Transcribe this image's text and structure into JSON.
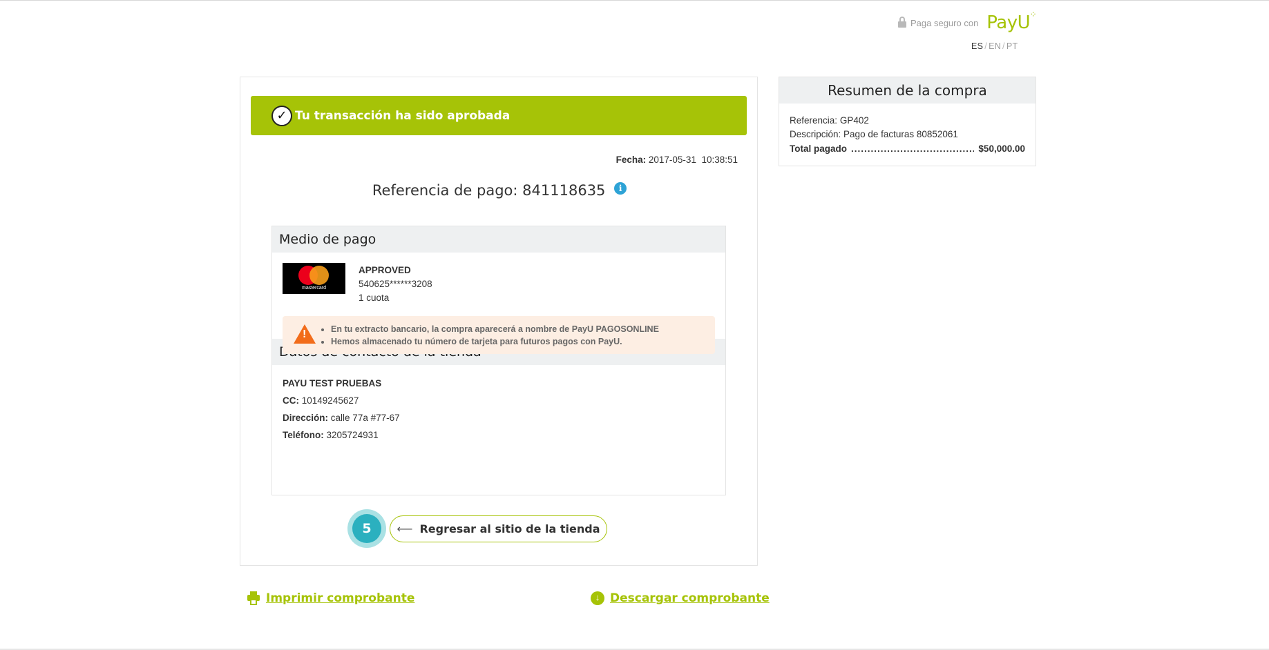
{
  "header": {
    "secure_text": "Paga seguro con",
    "brand": "PayU",
    "languages": [
      "ES",
      "EN",
      "PT"
    ],
    "active_language": "ES"
  },
  "main": {
    "banner_text": "Tu transacción ha sido aprobada",
    "fecha_label": "Fecha:",
    "fecha_value": "2017-05-31  10:38:51",
    "ref_label": "Referencia de pago:",
    "ref_value": "841118635",
    "medio_title": "Medio de pago",
    "card_brand": "mastercard",
    "status": "APPROVED",
    "card_number": "540625******3208",
    "cuotas": "1 cuota",
    "warnings": [
      "En tu extracto bancario, la compra aparecerá a nombre de PayU PAGOSONLINE",
      "Hemos almacenado tu número de tarjeta para futuros pagos con PayU."
    ],
    "contact_title": "Datos de contacto de la tienda",
    "store_name": "PAYU TEST PRUEBAS",
    "cc_label": "CC:",
    "cc_value": "10149245627",
    "dir_label": "Dirección:",
    "dir_value": "calle 77a #77-67",
    "tel_label": "Teléfono:",
    "tel_value": "3205724931",
    "step_number": "5",
    "back_label": "Regresar al sitio de la tienda",
    "print_label": "Imprimir comprobante",
    "download_label": "Descargar comprobante"
  },
  "summary": {
    "title": "Resumen de la compra",
    "ref_label": "Referencia:",
    "ref_value": "GP402",
    "desc_label": "Descripción:",
    "desc_value": "Pago de facturas 80852061",
    "total_label": "Total pagado",
    "total_value": "$50,000.00"
  },
  "colors": {
    "accent": "#a6c307",
    "info": "#2ea3d6",
    "warning": "#f26c1a",
    "step": "#2bb0bf"
  }
}
